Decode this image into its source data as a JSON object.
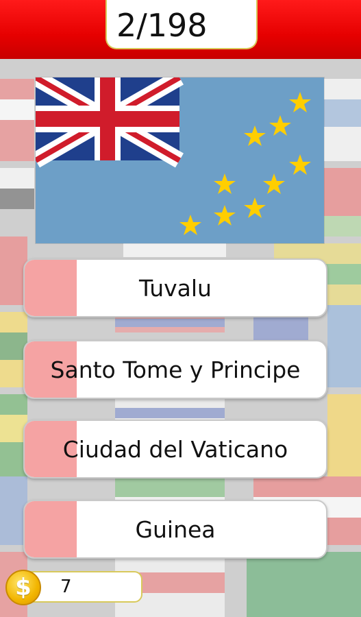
{
  "header": {
    "progress": "2/198"
  },
  "question": {
    "flag_icon": "tuvalu-flag"
  },
  "answers": [
    {
      "label": "Tuvalu"
    },
    {
      "label": "Santo Tome y Principe"
    },
    {
      "label": "Ciudad del Vaticano"
    },
    {
      "label": "Guinea"
    }
  ],
  "coins": {
    "icon": "dollar-coin-icon",
    "symbol": "$",
    "count": "7"
  },
  "colors": {
    "topbar": "#e60000",
    "answer_fill": "#f5a3a3",
    "flag_field": "#6d9fc7",
    "star": "#ffce00"
  }
}
